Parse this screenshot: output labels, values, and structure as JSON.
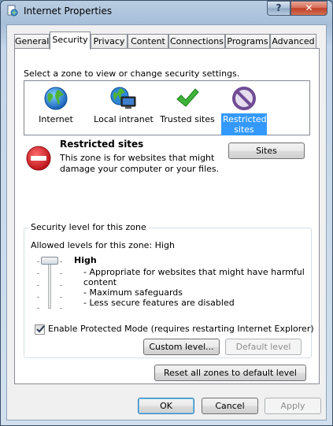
{
  "window": {
    "title": "Internet Properties",
    "help_glyph": "?",
    "close_glyph": "✕"
  },
  "tabs": [
    {
      "label": "General",
      "active": false
    },
    {
      "label": "Security",
      "active": true
    },
    {
      "label": "Privacy",
      "active": false
    },
    {
      "label": "Content",
      "active": false
    },
    {
      "label": "Connections",
      "active": false
    },
    {
      "label": "Programs",
      "active": false
    },
    {
      "label": "Advanced",
      "active": false
    }
  ],
  "security": {
    "zone_prompt": "Select a zone to view or change security settings.",
    "zones": [
      {
        "label": "Internet",
        "icon": "globe-icon",
        "selected": false
      },
      {
        "label": "Local intranet",
        "icon": "intranet-icon",
        "selected": false
      },
      {
        "label": "Trusted sites",
        "icon": "checkmark-icon",
        "selected": false
      },
      {
        "label_line1": "Restricted",
        "label_line2": "sites",
        "icon": "restricted-icon",
        "selected": true
      }
    ],
    "selected_zone": {
      "title": "Restricted sites",
      "description_line1": "This zone is for websites that might",
      "description_line2": "damage your computer or your files.",
      "icon": "no-entry-icon"
    },
    "sites_button": "Sites",
    "level_group": {
      "legend": "Security level for this zone",
      "allowed_levels": "Allowed levels for this zone: High",
      "level_name": "High",
      "bullets": [
        "- Appropriate for websites that might have harmful",
        "content",
        "- Maximum safeguards",
        "- Less secure features are disabled"
      ],
      "slider_level": "High",
      "protected_mode_label": "Enable Protected Mode (requires restarting Internet Explorer)",
      "protected_mode_checked": true,
      "custom_level_button": "Custom level...",
      "default_level_button": "Default level"
    },
    "reset_button": "Reset all zones to default level"
  },
  "footer": {
    "ok": "OK",
    "cancel": "Cancel",
    "apply": "Apply"
  },
  "colors": {
    "selection": "#3399ff",
    "restricted_purple": "#7d5aa0",
    "no_entry_red": "#d8232a"
  }
}
